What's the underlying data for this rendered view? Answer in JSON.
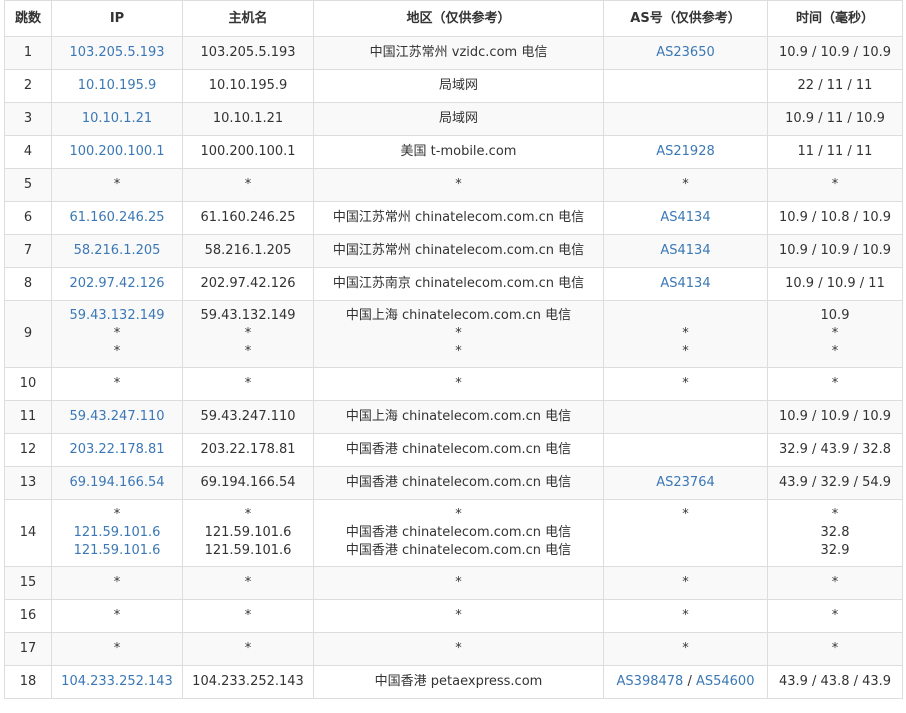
{
  "headers": [
    "跳数",
    "IP",
    "主机名",
    "地区（仅供参考）",
    "AS号（仅供参考）",
    "时间（毫秒）"
  ],
  "rows": [
    {
      "hop": "1",
      "lines": [
        {
          "ip": "103.205.5.193",
          "host": "103.205.5.193",
          "loc": "中国江苏常州 vzidc.com 电信",
          "as": [
            "AS23650"
          ],
          "time": "10.9 / 10.9 / 10.9"
        }
      ]
    },
    {
      "hop": "2",
      "lines": [
        {
          "ip": "10.10.195.9",
          "host": "10.10.195.9",
          "loc": "局域网",
          "as": [],
          "time": "22 / 11 / 11"
        }
      ]
    },
    {
      "hop": "3",
      "lines": [
        {
          "ip": "10.10.1.21",
          "host": "10.10.1.21",
          "loc": "局域网",
          "as": [],
          "time": "10.9 / 11 / 10.9"
        }
      ]
    },
    {
      "hop": "4",
      "lines": [
        {
          "ip": "100.200.100.1",
          "host": "100.200.100.1",
          "loc": "美国 t-mobile.com",
          "as": [
            "AS21928"
          ],
          "time": "11 / 11 / 11"
        }
      ]
    },
    {
      "hop": "5",
      "lines": [
        {
          "ip": "*",
          "host": "*",
          "loc": "*",
          "as": [
            "*"
          ],
          "time": "*"
        }
      ]
    },
    {
      "hop": "6",
      "lines": [
        {
          "ip": "61.160.246.25",
          "host": "61.160.246.25",
          "loc": "中国江苏常州 chinatelecom.com.cn 电信",
          "as": [
            "AS4134"
          ],
          "time": "10.9 / 10.8 / 10.9"
        }
      ]
    },
    {
      "hop": "7",
      "lines": [
        {
          "ip": "58.216.1.205",
          "host": "58.216.1.205",
          "loc": "中国江苏常州 chinatelecom.com.cn 电信",
          "as": [
            "AS4134"
          ],
          "time": "10.9 / 10.9 / 10.9"
        }
      ]
    },
    {
      "hop": "8",
      "lines": [
        {
          "ip": "202.97.42.126",
          "host": "202.97.42.126",
          "loc": "中国江苏南京 chinatelecom.com.cn 电信",
          "as": [
            "AS4134"
          ],
          "time": "10.9 / 10.9 / 11"
        }
      ]
    },
    {
      "hop": "9",
      "lines": [
        {
          "ip": "59.43.132.149",
          "host": "59.43.132.149",
          "loc": "中国上海 chinatelecom.com.cn 电信",
          "as": [],
          "time": "10.9"
        },
        {
          "ip": "*",
          "host": "*",
          "loc": "*",
          "as": [
            "*"
          ],
          "time": "*"
        },
        {
          "ip": "*",
          "host": "*",
          "loc": "*",
          "as": [
            "*"
          ],
          "time": "*"
        }
      ]
    },
    {
      "hop": "10",
      "lines": [
        {
          "ip": "*",
          "host": "*",
          "loc": "*",
          "as": [
            "*"
          ],
          "time": "*"
        }
      ]
    },
    {
      "hop": "11",
      "lines": [
        {
          "ip": "59.43.247.110",
          "host": "59.43.247.110",
          "loc": "中国上海 chinatelecom.com.cn 电信",
          "as": [],
          "time": "10.9 / 10.9 / 10.9"
        }
      ]
    },
    {
      "hop": "12",
      "lines": [
        {
          "ip": "203.22.178.81",
          "host": "203.22.178.81",
          "loc": "中国香港 chinatelecom.com.cn 电信",
          "as": [],
          "time": "32.9 / 43.9 / 32.8"
        }
      ]
    },
    {
      "hop": "13",
      "lines": [
        {
          "ip": "69.194.166.54",
          "host": "69.194.166.54",
          "loc": "中国香港 chinatelecom.com.cn 电信",
          "as": [
            "AS23764"
          ],
          "time": "43.9 / 32.9 / 54.9"
        }
      ]
    },
    {
      "hop": "14",
      "lines": [
        {
          "ip": "*",
          "host": "*",
          "loc": "*",
          "as": [
            "*"
          ],
          "time": "*"
        },
        {
          "ip": "121.59.101.6",
          "host": "121.59.101.6",
          "loc": "中国香港 chinatelecom.com.cn 电信",
          "as": [],
          "time": "32.8"
        },
        {
          "ip": "121.59.101.6",
          "host": "121.59.101.6",
          "loc": "中国香港 chinatelecom.com.cn 电信",
          "as": [],
          "time": "32.9"
        }
      ]
    },
    {
      "hop": "15",
      "lines": [
        {
          "ip": "*",
          "host": "*",
          "loc": "*",
          "as": [
            "*"
          ],
          "time": "*"
        }
      ]
    },
    {
      "hop": "16",
      "lines": [
        {
          "ip": "*",
          "host": "*",
          "loc": "*",
          "as": [
            "*"
          ],
          "time": "*"
        }
      ]
    },
    {
      "hop": "17",
      "lines": [
        {
          "ip": "*",
          "host": "*",
          "loc": "*",
          "as": [
            "*"
          ],
          "time": "*"
        }
      ]
    },
    {
      "hop": "18",
      "lines": [
        {
          "ip": "104.233.252.143",
          "host": "104.233.252.143",
          "loc": "中国香港 petaexpress.com",
          "as": [
            "AS398478",
            "AS54600"
          ],
          "time": "43.9 / 43.8 / 43.9"
        }
      ]
    }
  ],
  "colors": {
    "link": "#3b78b5",
    "text": "#333333",
    "border": "#dddddd",
    "stripe": "#f9f9f9"
  }
}
